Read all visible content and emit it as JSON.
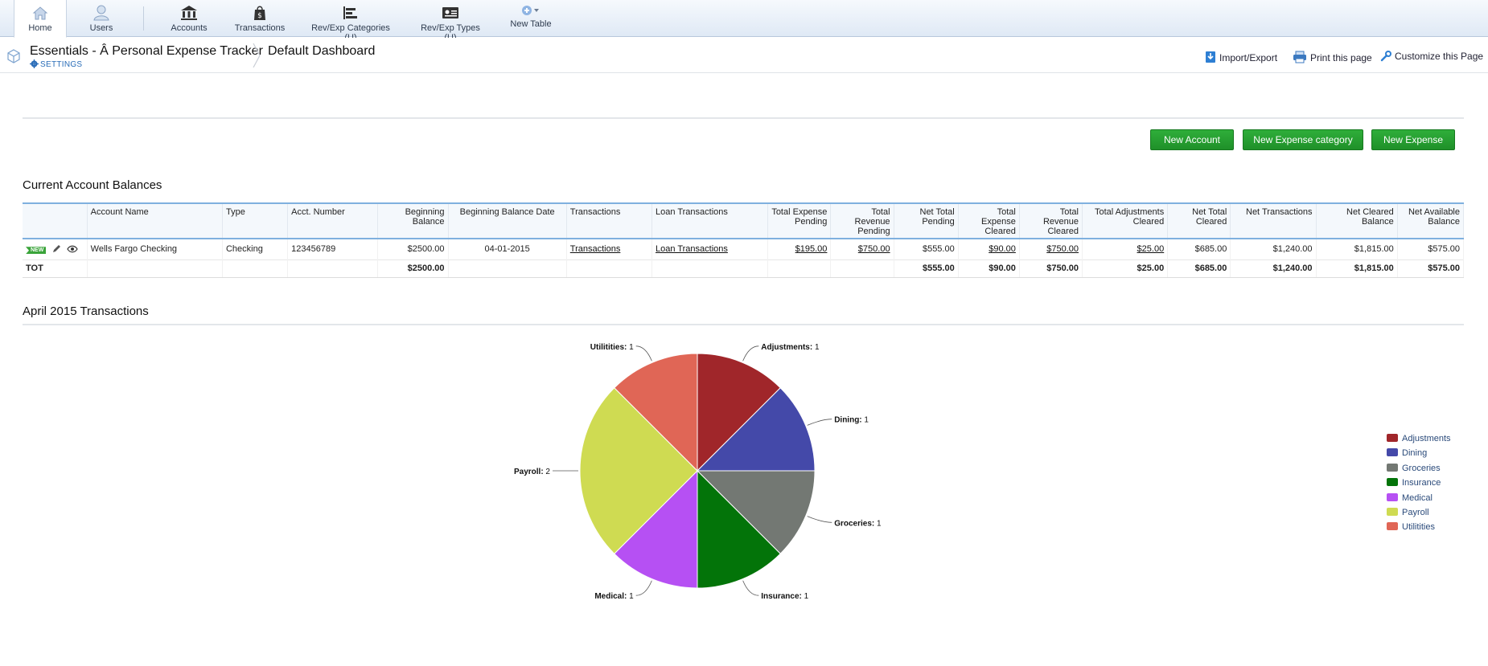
{
  "nav": {
    "items": [
      {
        "label": "Home",
        "icon": "home-icon",
        "active": true
      },
      {
        "label": "Users",
        "icon": "user-icon"
      },
      {
        "label": "Accounts",
        "icon": "bank-icon"
      },
      {
        "label": "Transactions",
        "icon": "shopping-bag-icon"
      },
      {
        "label": "Rev/Exp Categories (U)",
        "icon": "categories-icon"
      },
      {
        "label": "Rev/Exp Types (U)",
        "icon": "id-card-icon"
      },
      {
        "label": "New Table",
        "icon": "add-table-icon"
      }
    ]
  },
  "header": {
    "app_title": "Essentials - Â Personal Expense Tracker",
    "settings": "SETTINGS",
    "dashboard": "Default Dashboard",
    "actions": {
      "import_export": "Import/Export",
      "print": "Print this page",
      "customize": "Customize this Page"
    }
  },
  "buttons": {
    "new_account": "New Account",
    "new_expense_category": "New Expense category",
    "new_expense": "New Expense"
  },
  "balances": {
    "title": "Current Account Balances",
    "headers": {
      "account_name": "Account Name",
      "type": "Type",
      "acct_number": "Acct. Number",
      "beginning_balance": "Beginning Balance",
      "beginning_balance_date": "Beginning Balance Date",
      "transactions": "Transactions",
      "loan_transactions": "Loan Transactions",
      "total_expense_pending": "Total Expense Pending",
      "total_revenue_pending": "Total Revenue Pending",
      "net_total_pending": "Net Total Pending",
      "total_expense_cleared": "Total Expense Cleared",
      "total_revenue_cleared": "Total Revenue Cleared",
      "total_adjustments_cleared": "Total Adjustments Cleared",
      "net_total_cleared": "Net Total Cleared",
      "net_transactions": "Net Transactions",
      "net_cleared_balance": "Net Cleared Balance",
      "net_available_balance": "Net Available Balance"
    },
    "row": {
      "badge": "NEW",
      "account_name": "Wells Fargo Checking",
      "type": "Checking",
      "acct_number": "123456789",
      "beginning_balance": "$2500.00",
      "beginning_balance_date": "04-01-2015",
      "transactions": "Transactions",
      "loan_transactions": "Loan Transactions",
      "total_expense_pending": "$195.00",
      "total_revenue_pending": "$750.00",
      "net_total_pending": "$555.00",
      "total_expense_cleared": "$90.00",
      "total_revenue_cleared": "$750.00",
      "total_adjustments_cleared": "$25.00",
      "net_total_cleared": "$685.00",
      "net_transactions": "$1,240.00",
      "net_cleared_balance": "$1,815.00",
      "net_available_balance": "$575.00"
    },
    "total": {
      "label": "TOT",
      "beginning_balance": "$2500.00",
      "net_total_pending": "$555.00",
      "total_expense_cleared": "$90.00",
      "total_revenue_cleared": "$750.00",
      "total_adjustments_cleared": "$25.00",
      "net_total_cleared": "$685.00",
      "net_transactions": "$1,240.00",
      "net_cleared_balance": "$1,815.00",
      "net_available_balance": "$575.00"
    }
  },
  "transactions_section": {
    "title": "April 2015 Transactions"
  },
  "chart_data": {
    "type": "pie",
    "title": "",
    "categories": [
      "Adjustments",
      "Dining",
      "Groceries",
      "Insurance",
      "Medical",
      "Payroll",
      "Utilitities"
    ],
    "values": [
      1,
      1,
      1,
      1,
      1,
      2,
      1
    ],
    "colors": [
      "#a0262a",
      "#4449a9",
      "#737873",
      "#037409",
      "#b650f3",
      "#cfdb52",
      "#e06656"
    ],
    "legend_position": "right"
  }
}
